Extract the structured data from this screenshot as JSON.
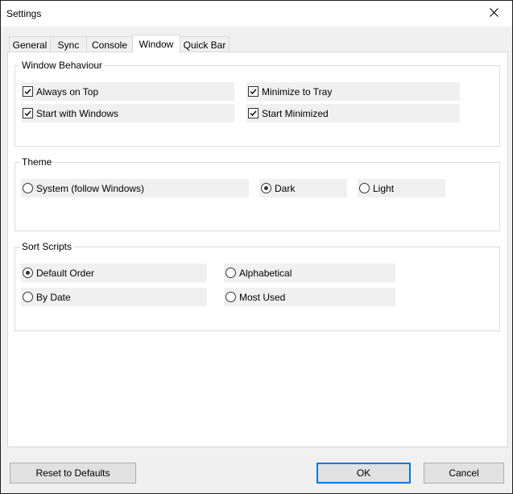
{
  "window": {
    "title": "Settings"
  },
  "tabs": [
    "General",
    "Sync",
    "Console",
    "Window",
    "Quick Bar"
  ],
  "active_tab": "Window",
  "groups": {
    "window_behaviour": {
      "title": "Window Behaviour",
      "options": [
        {
          "label": "Always on Top",
          "checked": true
        },
        {
          "label": "Minimize to Tray",
          "checked": true
        },
        {
          "label": "Start with Windows",
          "checked": true
        },
        {
          "label": "Start Minimized",
          "checked": true
        }
      ]
    },
    "theme": {
      "title": "Theme",
      "options": [
        {
          "label": "System (follow Windows)",
          "selected": false
        },
        {
          "label": "Dark",
          "selected": true
        },
        {
          "label": "Light",
          "selected": false
        }
      ]
    },
    "sort_scripts": {
      "title": "Sort Scripts",
      "options": [
        {
          "label": "Default Order",
          "selected": true
        },
        {
          "label": "Alphabetical",
          "selected": false
        },
        {
          "label": "By Date",
          "selected": false
        },
        {
          "label": "Most Used",
          "selected": false
        }
      ]
    }
  },
  "buttons": {
    "reset": "Reset to Defaults",
    "ok": "OK",
    "cancel": "Cancel"
  },
  "colors": {
    "accent": "#0078d7",
    "option_bg": "#f0f0f0",
    "panel_bg": "#ffffff",
    "window_bg": "#f0f0f0"
  },
  "icons": {
    "close": "close-icon",
    "check": "checkmark-icon"
  }
}
